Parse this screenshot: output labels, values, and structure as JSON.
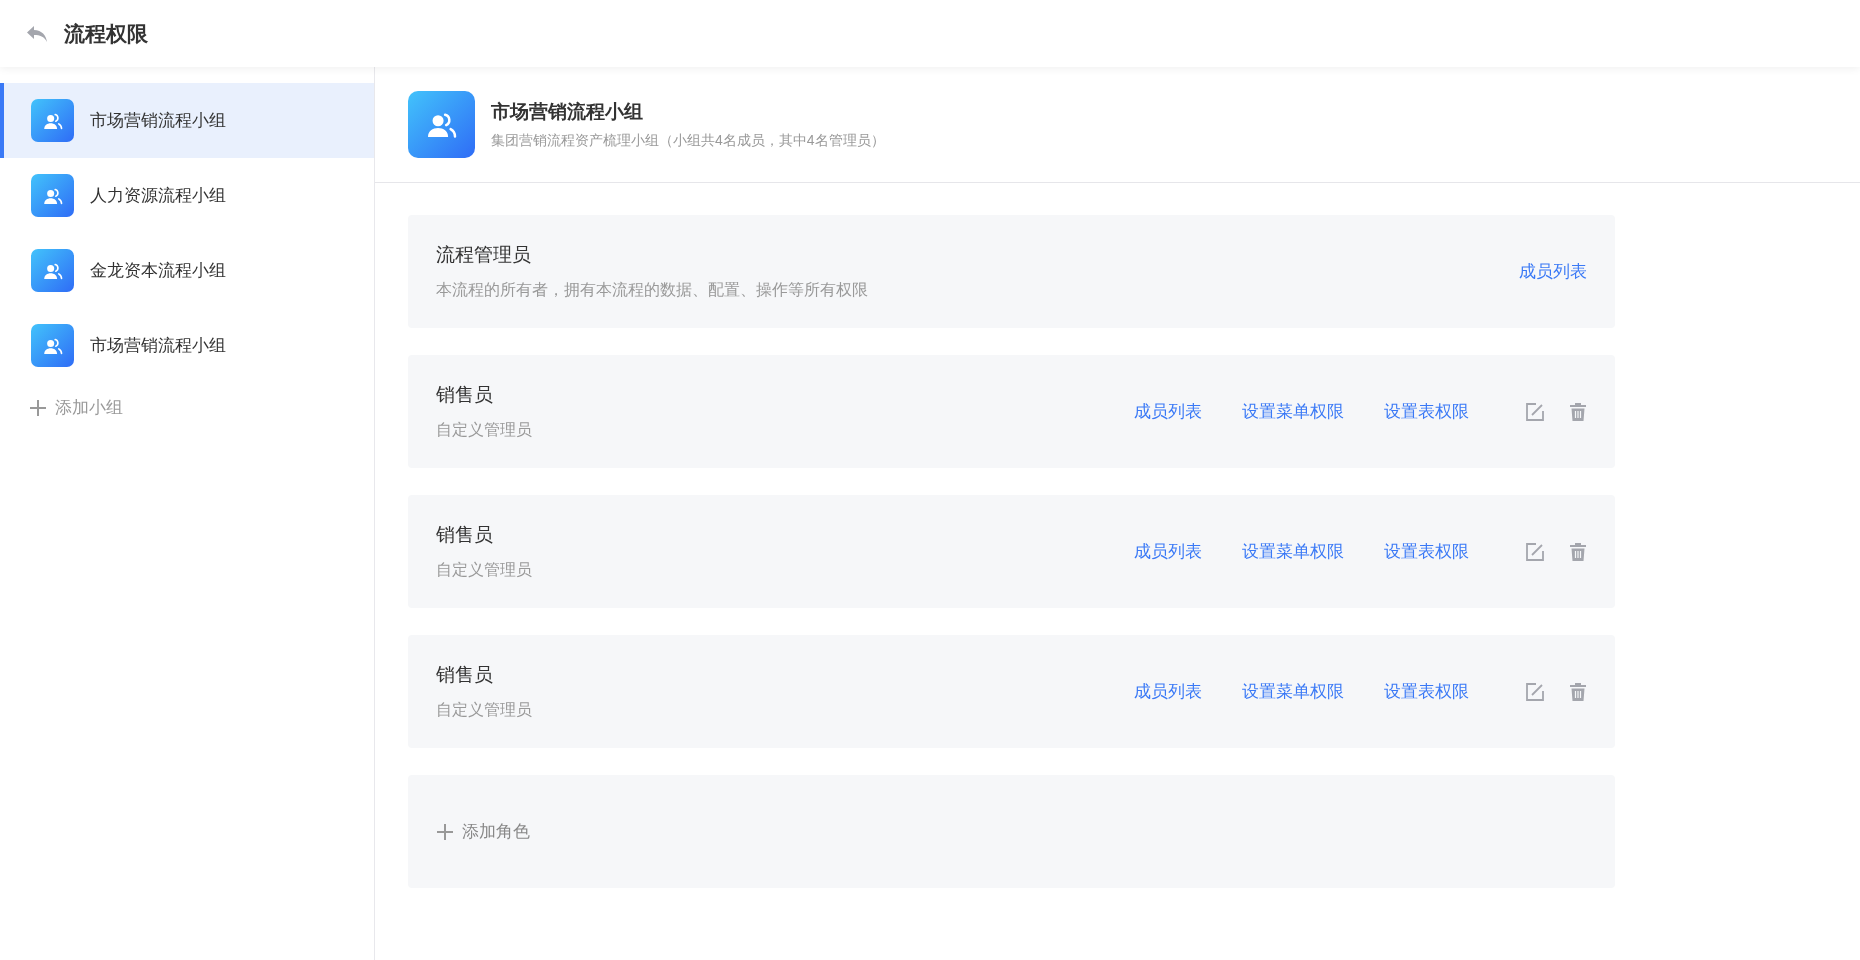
{
  "header": {
    "title": "流程权限"
  },
  "sidebar": {
    "groups": [
      {
        "name": "市场营销流程小组",
        "selected": true
      },
      {
        "name": "人力资源流程小组",
        "selected": false
      },
      {
        "name": "金龙资本流程小组",
        "selected": false
      },
      {
        "name": "市场营销流程小组",
        "selected": false
      }
    ],
    "add_label": "添加小组"
  },
  "group": {
    "name": "市场营销流程小组",
    "description": "集团营销流程资产梳理小组（小组共4名成员，其中4名管理员）"
  },
  "roles": [
    {
      "kind": "owner",
      "name": "流程管理员",
      "description": "本流程的所有者，拥有本流程的数据、配置、操作等所有权限",
      "actions": [
        "成员列表"
      ]
    },
    {
      "kind": "custom",
      "name": "销售员",
      "description": "自定义管理员",
      "actions": [
        "成员列表",
        "设置菜单权限",
        "设置表权限"
      ]
    },
    {
      "kind": "custom",
      "name": "销售员",
      "description": "自定义管理员",
      "actions": [
        "成员列表",
        "设置菜单权限",
        "设置表权限"
      ]
    },
    {
      "kind": "custom",
      "name": "销售员",
      "description": "自定义管理员",
      "actions": [
        "成员列表",
        "设置菜单权限",
        "设置表权限"
      ]
    }
  ],
  "add_role_label": "添加角色"
}
